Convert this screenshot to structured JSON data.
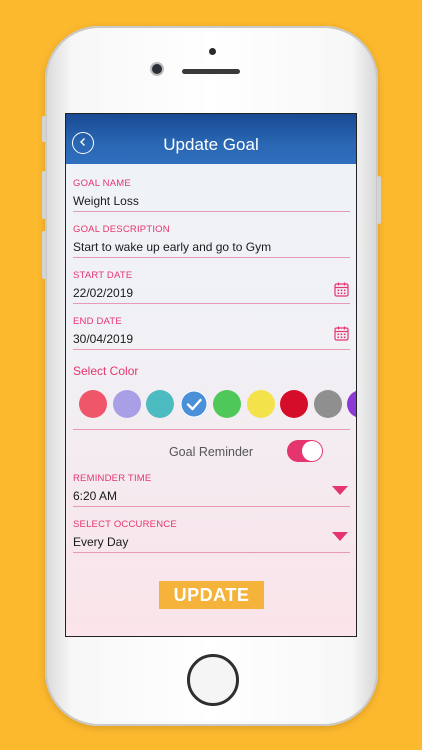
{
  "header": {
    "title": "Update Goal",
    "back_icon": "back-arrow-icon"
  },
  "form": {
    "goal_name": {
      "label": "GOAL NAME",
      "value": "Weight Loss"
    },
    "goal_description": {
      "label": "GOAL DESCRIPTION",
      "value": "Start to wake up early and go to Gym"
    },
    "start_date": {
      "label": "START DATE",
      "value": "22/02/2019",
      "icon": "calendar-icon"
    },
    "end_date": {
      "label": "END DATE",
      "value": "30/04/2019",
      "icon": "calendar-icon"
    },
    "color": {
      "label": "Select Color",
      "swatches": [
        "#f0566a",
        "#a99fe6",
        "#4cbcc0",
        "#4a90d9",
        "#4fc85a",
        "#f4e24a",
        "#d50d2a",
        "#8f8f8f",
        "#8b3ad6"
      ],
      "selected_index": 3,
      "selected_icon": "checkmark-icon"
    },
    "goal_reminder": {
      "label": "Goal Reminder",
      "enabled": true
    },
    "reminder_time": {
      "label": "REMINDER TIME",
      "value": "6:20 AM",
      "icon": "dropdown-arrow-icon"
    },
    "occurrence": {
      "label": "SELECT OCCURENCE",
      "value": "Every Day",
      "icon": "dropdown-arrow-icon"
    }
  },
  "actions": {
    "update_label": "UPDATE"
  },
  "colors": {
    "accent": "#e5356f",
    "header": "#2a67b4",
    "button": "#f6b33c",
    "background": "#FDB92E"
  }
}
